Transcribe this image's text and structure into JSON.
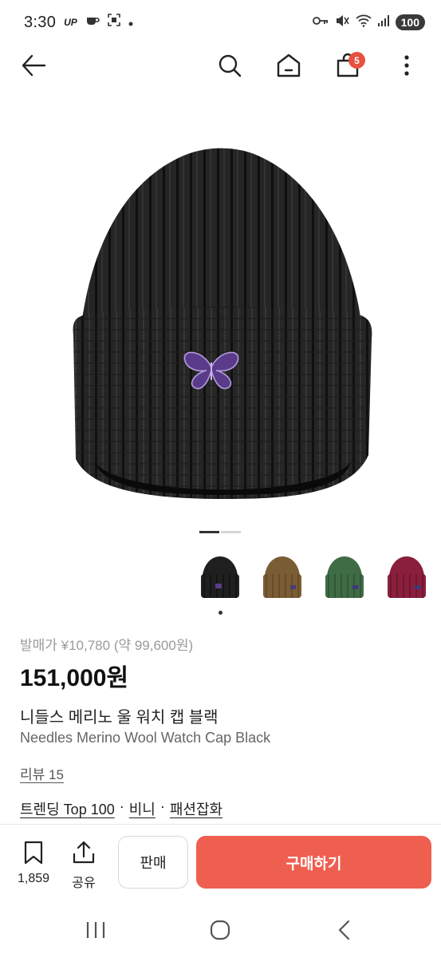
{
  "status_bar": {
    "time": "3:30",
    "carrier_tag": "UP",
    "battery": "100"
  },
  "nav": {
    "cart_count": "5",
    "icons": [
      "back-arrow-icon",
      "search-icon",
      "home-icon",
      "shopping-bag-icon",
      "more-vert-icon"
    ]
  },
  "product": {
    "release_price": "발매가 ¥10,780 (약 99,600원)",
    "price": "151,000원",
    "name_ko": "니들스 메리노 울 워치 캡 블랙",
    "name_en": "Needles Merino Wool Watch Cap Black",
    "review": "리뷰 15",
    "breadcrumbs": {
      "trending": "트렌딩 Top 100",
      "sep1": "·",
      "beanie": "비니",
      "sep2": "·",
      "category": "패션잡화"
    },
    "image_pages": 2,
    "current_page": 1,
    "thumbnails": [
      {
        "color": "#1f1f1f",
        "label": "black"
      },
      {
        "color": "#7a5c35",
        "label": "brown"
      },
      {
        "color": "#3f6b45",
        "label": "green"
      },
      {
        "color": "#8a1f3d",
        "label": "burgundy"
      }
    ]
  },
  "actions": {
    "save_count": "1,859",
    "share": "공유",
    "sell": "판매",
    "buy": "구매하기"
  },
  "colors": {
    "accent": "#ef5f50",
    "badge": "#e8503f"
  }
}
